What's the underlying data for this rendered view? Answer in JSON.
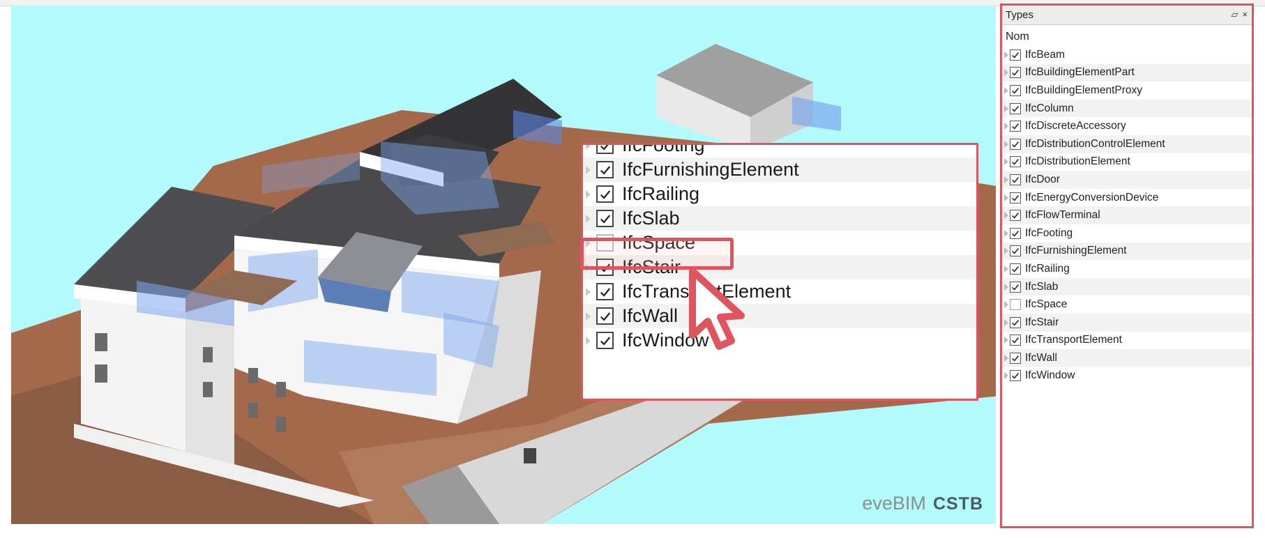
{
  "panel": {
    "title": "Types",
    "pin_icon": "pin-icon",
    "close_label": "×",
    "column_header": "Nom",
    "items": [
      {
        "label": "IfcBeam",
        "checked": true
      },
      {
        "label": "IfcBuildingElementPart",
        "checked": true
      },
      {
        "label": "IfcBuildingElementProxy",
        "checked": true
      },
      {
        "label": "IfcColumn",
        "checked": true
      },
      {
        "label": "IfcDiscreteAccessory",
        "checked": true
      },
      {
        "label": "IfcDistributionControlElement",
        "checked": true
      },
      {
        "label": "IfcDistributionElement",
        "checked": true
      },
      {
        "label": "IfcDoor",
        "checked": true
      },
      {
        "label": "IfcEnergyConversionDevice",
        "checked": true
      },
      {
        "label": "IfcFlowTerminal",
        "checked": true
      },
      {
        "label": "IfcFooting",
        "checked": true
      },
      {
        "label": "IfcFurnishingElement",
        "checked": true
      },
      {
        "label": "IfcRailing",
        "checked": true
      },
      {
        "label": "IfcSlab",
        "checked": true
      },
      {
        "label": "IfcSpace",
        "checked": false
      },
      {
        "label": "IfcStair",
        "checked": true
      },
      {
        "label": "IfcTransportElement",
        "checked": true
      },
      {
        "label": "IfcWall",
        "checked": true
      },
      {
        "label": "IfcWindow",
        "checked": true
      }
    ]
  },
  "zoom": {
    "items": [
      {
        "label": "IfcFooting",
        "checked": true
      },
      {
        "label": "IfcFurnishingElement",
        "checked": true
      },
      {
        "label": "IfcRailing",
        "checked": true
      },
      {
        "label": "IfcSlab",
        "checked": true
      },
      {
        "label": "IfcSpace",
        "checked": false
      },
      {
        "label": "IfcStair",
        "checked": true
      },
      {
        "label": "IfcTransportElement",
        "checked": true
      },
      {
        "label": "IfcWall",
        "checked": true
      },
      {
        "label": "IfcWindow",
        "checked": true
      }
    ]
  },
  "brand": {
    "eve": "eve",
    "bim": "BIM",
    "cstb": "CSTB"
  },
  "colors": {
    "sky": "#b3fafc",
    "highlight": "#e0545d",
    "terrain": "#a4694a"
  }
}
